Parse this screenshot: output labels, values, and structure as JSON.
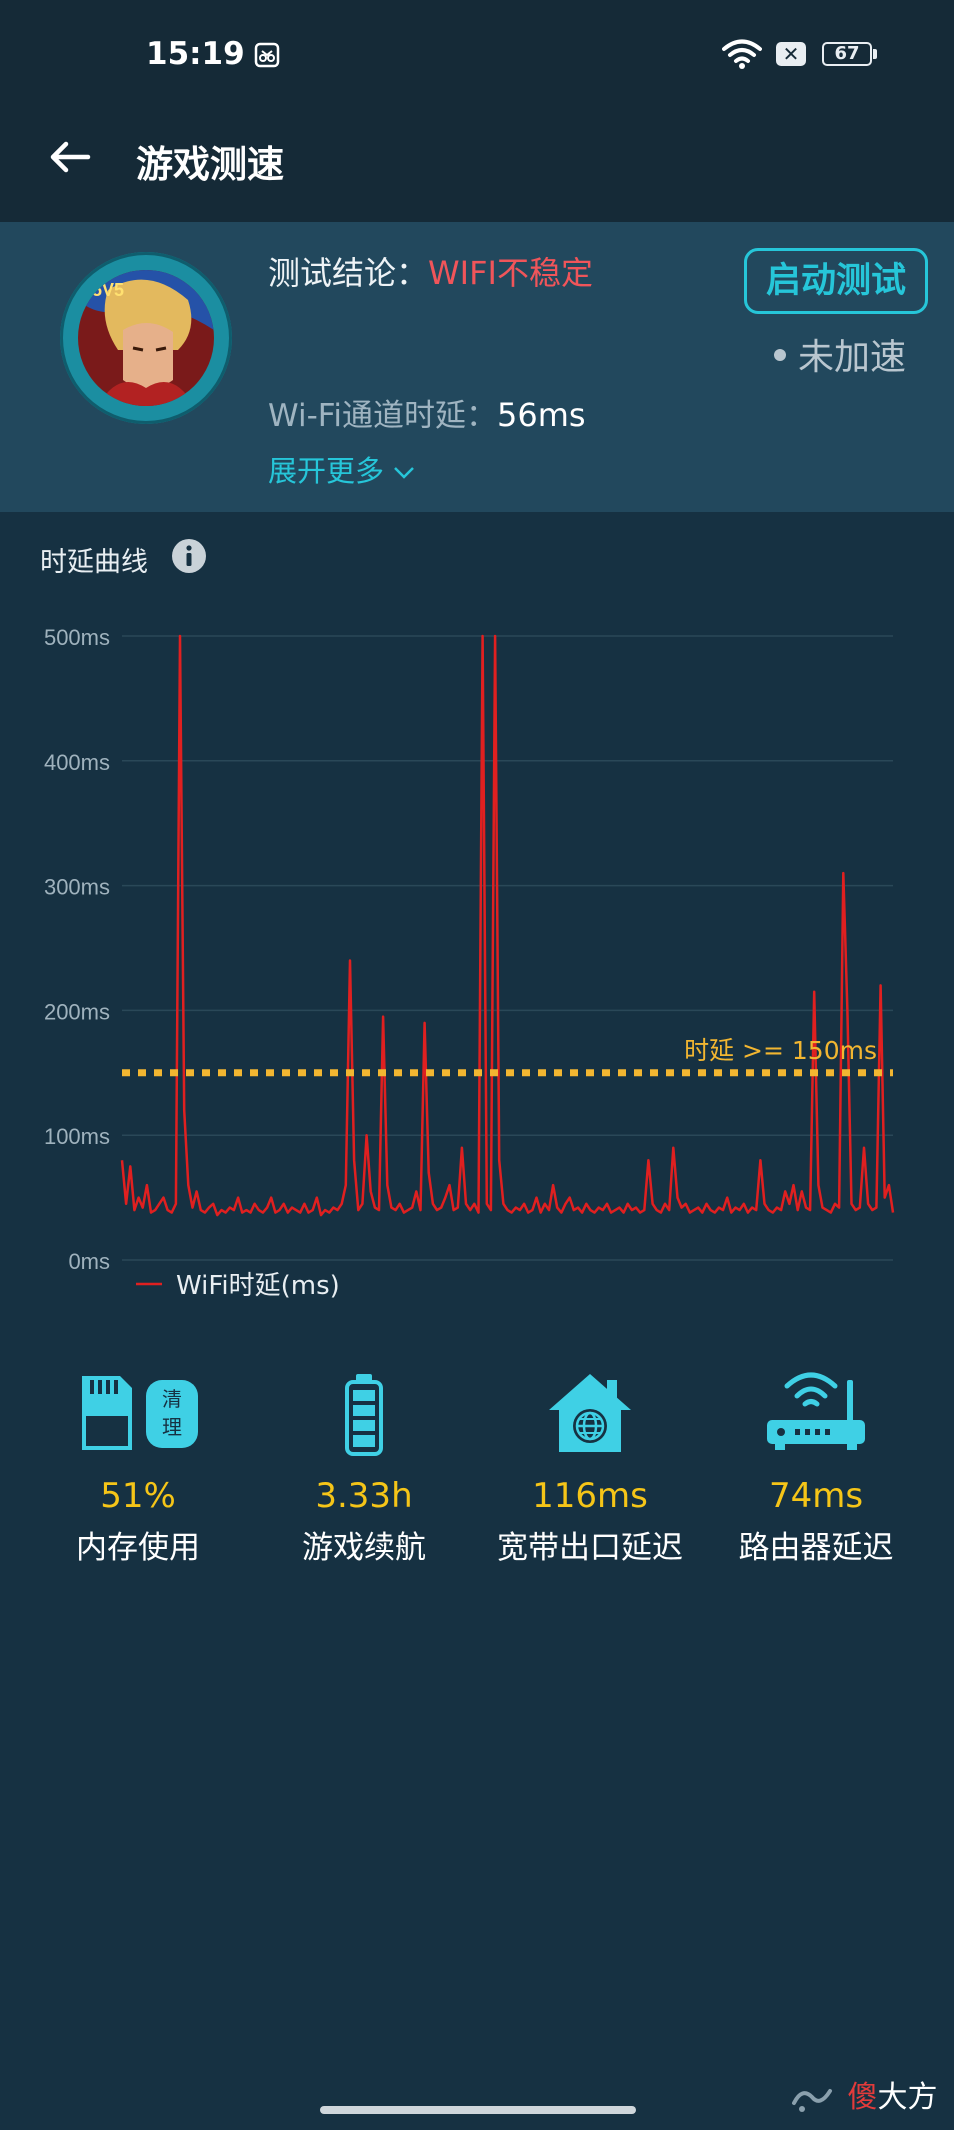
{
  "status_bar": {
    "time": "15:19",
    "battery": "67",
    "battery_level": 0.67,
    "x_badge": "✕"
  },
  "nav": {
    "title": "游戏测速"
  },
  "summary": {
    "conclusion_label": "测试结论：",
    "conclusion_value": "WIFI不稳定",
    "start_button": "启动测试",
    "accel_status": "未加速",
    "latency_label": "Wi-Fi通道时延：",
    "latency_value": "56ms",
    "expand_label": "展开更多"
  },
  "chart_section": {
    "title": "时延曲线"
  },
  "chart_data": {
    "type": "line",
    "y_ticks": [
      "500ms",
      "400ms",
      "300ms",
      "200ms",
      "100ms",
      "0ms"
    ],
    "ylim": [
      0,
      500
    ],
    "threshold": {
      "value": 150,
      "label": "时延 >= 150ms",
      "color": "#f2b631"
    },
    "series": [
      {
        "name": "WiFi时延(ms)",
        "color": "#e02020",
        "values": [
          80,
          45,
          75,
          40,
          50,
          42,
          60,
          38,
          40,
          45,
          50,
          40,
          38,
          45,
          500,
          120,
          60,
          42,
          55,
          40,
          38,
          42,
          45,
          36,
          40,
          38,
          42,
          40,
          50,
          38,
          40,
          38,
          45,
          40,
          38,
          42,
          50,
          38,
          40,
          45,
          38,
          42,
          40,
          38,
          45,
          38,
          40,
          50,
          36,
          40,
          38,
          42,
          40,
          45,
          60,
          240,
          80,
          40,
          45,
          100,
          55,
          42,
          40,
          195,
          60,
          42,
          40,
          45,
          38,
          40,
          42,
          55,
          40,
          190,
          70,
          45,
          40,
          42,
          50,
          60,
          40,
          42,
          90,
          45,
          40,
          45,
          38,
          500,
          45,
          40,
          500,
          80,
          45,
          40,
          38,
          42,
          40,
          45,
          38,
          40,
          50,
          38,
          45,
          40,
          60,
          42,
          38,
          45,
          50,
          40,
          42,
          38,
          45,
          40,
          38,
          42,
          40,
          45,
          38,
          40,
          42,
          38,
          45,
          40,
          42,
          38,
          40,
          80,
          45,
          40,
          38,
          45,
          40,
          90,
          50,
          42,
          45,
          38,
          40,
          42,
          38,
          45,
          40,
          38,
          42,
          40,
          50,
          38,
          42,
          40,
          45,
          38,
          42,
          40,
          80,
          45,
          40,
          38,
          42,
          40,
          55,
          45,
          60,
          40,
          55,
          42,
          40,
          215,
          60,
          42,
          40,
          38,
          45,
          42,
          310,
          200,
          45,
          40,
          42,
          90,
          45,
          40,
          42,
          220,
          50,
          60,
          38
        ]
      }
    ]
  },
  "stats": [
    {
      "icon": "sd-card-icon",
      "value": "51%",
      "label": "内存使用",
      "badge": "清理"
    },
    {
      "icon": "battery-icon",
      "value": "3.33h",
      "label": "游戏续航"
    },
    {
      "icon": "home-globe-icon",
      "value": "116ms",
      "label": "宽带出口延迟"
    },
    {
      "icon": "router-icon",
      "value": "74ms",
      "label": "路由器延迟"
    }
  ],
  "watermark": {
    "text_red": "傻",
    "text_white": "大方"
  },
  "colors": {
    "accent": "#26c6d9",
    "warning": "#f0555a",
    "value_yellow": "#f5c518",
    "background": "#163142",
    "card": "#22485d"
  }
}
